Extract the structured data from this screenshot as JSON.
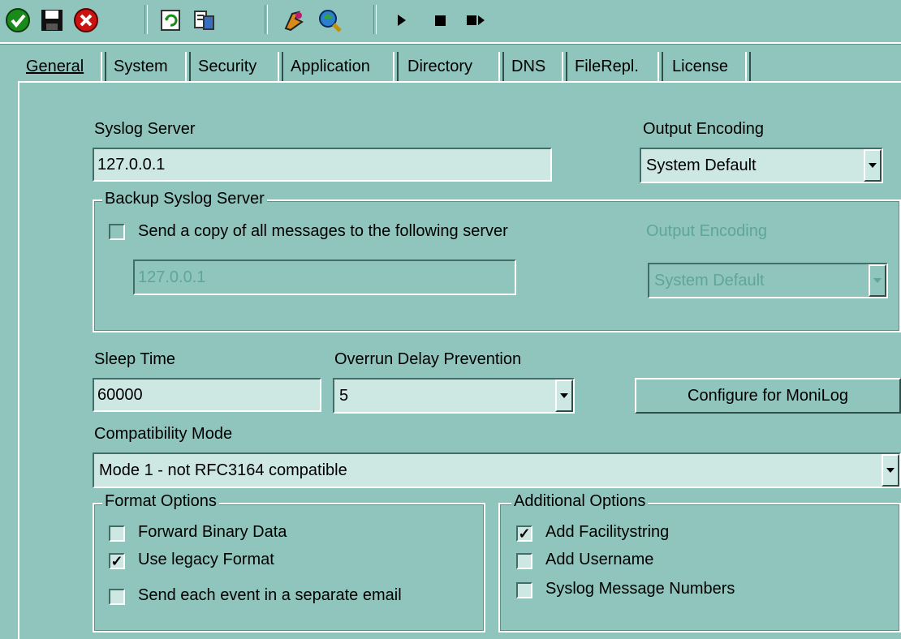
{
  "toolbar": {
    "icons": [
      "ok-icon",
      "save-icon",
      "cancel-icon",
      "refresh-icon",
      "register-icon",
      "debug-icon",
      "globe-search-icon",
      "play-icon",
      "stop-icon",
      "skip-icon"
    ]
  },
  "tabs": [
    {
      "label": "General",
      "active": true
    },
    {
      "label": "System"
    },
    {
      "label": "Security"
    },
    {
      "label": "Application"
    },
    {
      "label": "Directory"
    },
    {
      "label": "DNS"
    },
    {
      "label": "FileRepl."
    },
    {
      "label": "License"
    }
  ],
  "general": {
    "syslog_server_label": "Syslog Server",
    "syslog_server_value": "127.0.0.1",
    "output_encoding_label": "Output Encoding",
    "output_encoding_value": "System Default",
    "backup": {
      "title": "Backup Syslog Server",
      "send_copy_label": "Send a copy of all messages to the following server",
      "send_copy_checked": false,
      "server_value": "127.0.0.1",
      "output_encoding_label": "Output Encoding",
      "output_encoding_value": "System Default"
    },
    "sleep_time_label": "Sleep Time",
    "sleep_time_value": "60000",
    "overrun_label": "Overrun Delay Prevention",
    "overrun_value": "5",
    "configure_button": "Configure for MoniLog",
    "compat_label": "Compatibility Mode",
    "compat_value": "Mode 1 - not RFC3164 compatible",
    "format_options": {
      "title": "Format Options",
      "items": [
        {
          "label": "Forward Binary Data",
          "checked": false
        },
        {
          "label": "Use legacy Format",
          "checked": true
        },
        {
          "label": "Send each event in a separate email",
          "checked": false
        }
      ]
    },
    "additional_options": {
      "title": "Additional Options",
      "items": [
        {
          "label": "Add Facilitystring",
          "checked": true
        },
        {
          "label": "Add Username",
          "checked": false
        },
        {
          "label": "Syslog Message Numbers",
          "checked": false
        }
      ]
    }
  },
  "colors": {
    "background": "#8fc5bd",
    "field": "#cde7e3",
    "disabled_text": "#5fa59b"
  }
}
